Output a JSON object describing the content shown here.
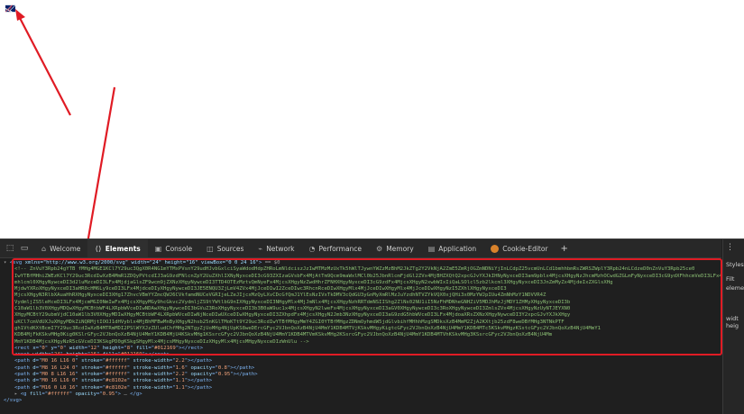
{
  "devtools": {
    "tabs": [
      {
        "label": "Welcome",
        "icon": "home-icon"
      },
      {
        "label": "Elements",
        "icon": "elements-icon",
        "active": true
      },
      {
        "label": "Console",
        "icon": "console-icon"
      },
      {
        "label": "Sources",
        "icon": "sources-icon"
      },
      {
        "label": "Network",
        "icon": "network-icon"
      },
      {
        "label": "Performance",
        "icon": "performance-icon"
      },
      {
        "label": "Memory",
        "icon": "memory-icon"
      },
      {
        "label": "Application",
        "icon": "application-icon"
      },
      {
        "label": "Cookie-Editor",
        "icon": "cookie-icon"
      }
    ],
    "add_tab": "+",
    "side": {
      "styles": "Styles",
      "filter": "Filt",
      "element": "element",
      "width": "widt",
      "heig": "heig"
    },
    "dom": {
      "svg_open_tag": "svg",
      "svg_attrs": "xmlns=\"http://www.w3.org/2000/svg\" width=\"24\" height=\"16\" viewBox=\"0 0 24 16\"",
      "svg_suffix": "== $0",
      "comment_lines": [
        "<!-- ZnVuY3Rpb24gYTB fMHg4MGE1KCl7Y29uc3QgX0R4NG1mYTMxPVsnY29udHJvbGxlciSyaWdodHdpZHRoLmNldciszJzIwMTMzMzUxTk5hWlTJywnYWZzMzBhM2JkZTg2Y2VkNjA2ZmE5ZmRjOGZmNDNiYjInLCdpZ25vcmUnLCd1bmhhbmRsZWRSZWplY3Rpb24nLCdzeD0nZnVuY3Rpb25ce0",
        "IwYTBfMHhiZWEzKCl7Y29uc3RcdIwXzB4MmR1ZDQyPVtcdIJ3aG9zdFNlcnZpY2UuZXhlIXNyNyxceDI3cG93ZXIzaGVsbFx4MjAtTm9Qcm9maWxlMCl0b25JbnRlcmFjdGl2ZVx4MjBHZXQtQ2xpcGJvYXJkIHNyNyxceDI3am9pblx4MjcsXHgyNzJhcmMzhOCwdGZGLmFyNyxceDI3cG9ydXFhhcmVeDI3LFx4MjdpbmhLcm",
        "mhlcml0XHgyNywceDI3d2luMzceDI3LFx4MjdjaGlsZF9wcm9jZXNzXHgyNywceDI3TTD4OTEzMztvQmNyeFx4MjcsXHgyNzZwdHhrZFNHXHgyNyxceDI3cG9zdFx4MjcsXHgyN2xwbWIxIiQaLSOlcl5zb2lkcml3XHgyNyxceDI3JnZmMyZx4MjdeIxZXGlsXHg",
        "MjdwYXRoXHgyNyxceDI3aHR0cHM6Ly9ceDI3LFx4MjdceDIyXHgyNywceDI3JE5ENQU3ZjLmV4ZVx4MjJceDIwI2ZceDIwc3RhcnRceDIwXHgyMlx4MjJceDIwXHgyMlx4MjJceDIwXHgyNzI5ZXhlXHgyNyxceDI3",
        "MjcsXHgyN3RlbXAuaHhRXHgyNyxceDI3XHg17ZhvcVBmYYZmcQWJ6CVkfamdNUCeVGRIjeLZeJIjcxMzQyLXvCDcGfQmJ1YlEsNzIVxTkDMV3cQdGU3yGnMyXmRlMzJuYzdhNTVZYkVQX0xjQHi3x0MzYWJpIUu4ZmNhMzY1NDVVR4Z",
        "VydmljZS5leHceDI3LFx4MjcmMGI0NmIwFx4MjcsXHgyMGy9hcGkvc2VydmljZS9tYWtlbG9nIXHgyNyxceDI3NHgyMlx4MjJmNlx4MjcsXHgyNzhRRTdmNSIIShg2ZlNs02NU1iI5NzFhMDNheGNHZiV5MDJhMzJjMDY1ZHMyXHgyNyxceDI3b",
        "C10aW1lb3V0XHgyMDQwXHgyMCBtbWF4LXRpbWVceDIwNDAwXHgyNywceDI3bGVuZ3RoXHgyNyxceDI3b3B0aW9uc1x4MjcsXHgyN2lweFx4MjcsXHgyNyxceDI3aGV0XHgyNywceDI3c3RoXHgyNywceDI3ZmlsZVx4MjcsXHgyNzUyNTJEYXN0",
        "XHgyMCBtY29ubmVjdC10aW1lb3V0XHgyMDIwXHgyMCBtbWF4LXRpbWVceDIwNjNceDIwUXceDIwXHgyNyxceDI3ZXhpdFx4MjcsXHgyN2Jmb3NzXHgyNyxceDI3aG9zdG5hbWVceDI3LFx4MjdoaXRsZXNzXHgyNywceDI3Y2xpcGJvYXJkXHgy",
        "uKCl7cmVdUXJuXHgyMDkZiNQRMjtIOOJ1dHVyblx4MjBhMFBwMnByXHgyN2hsb25nKGlTMoKTt9Y29uc3RcdIwYTBfMHgyMmY4ZGI0YTBfMHgzZDNmOyhmdW5jdGlvbihfMHhhMzgSMDksXzB4MmM2ZjA2KXtjb25zdF8weDBfMHg3NTNkPTF",
        "gh1VtdKXtBcmI7Y29uc3RcdIwXzB4MTRmMDI2PSlWYXJzZUludChfMHg2NTgyZjUoMHg4NjUpKS8weDErcGFyc2VJbnQoXzB4NjU4MmY1KDB4MTVjKSkvMHgyKigtcGFyc2VJbnQoXzB4NjU4MmY1KDB4MTc5KSkvMHgzKSstcGFyc2VJbnQoXzB4NjU4MmY1",
        "KDB4MjFkKSkvMHg0Kig0KSlrGFyc2VJbnQoXzB4NjU4MmY1KDB4MjU4KSkvMHg1KSsrcGFyc2VJbnQoXzB4NjU4MmY1KDB4MTVmKSkvMHg2KSsrcGFyc2VJbnQoXzB4NjU4MmY1KDB4MTVhKSkvMHg3KSsrcGFyc2VJbnQoXzB4NjU4Mm",
        "MmY1KDB4MjcsXHgyNzR5cGVceDI3KSkgPD0gKSkgSHgyMlx4MjcsMHgyNyxceDIzXHgyMlx4MjcsMHgyNyxceDIzWnUlu -->"
      ],
      "children": [
        {
          "tag": "rect",
          "attrs": [
            [
              "x",
              "0"
            ],
            [
              "y",
              "0"
            ],
            [
              "width",
              "12"
            ],
            [
              "height",
              "8"
            ],
            [
              "fill",
              "#012169"
            ]
          ],
          "close": "</rect>"
        },
        {
          "tag": "rect",
          "attrs": [
            [
              "width",
              "24"
            ],
            [
              "height",
              "16"
            ],
            [
              "fill",
              "#012169"
            ]
          ],
          "close": "</rect>"
        },
        {
          "tag": "path",
          "attrs": [
            [
              "d",
              "M0 16 L16 0"
            ],
            [
              "stroke",
              "#ffffff"
            ],
            [
              "stroke-width",
              "2.2"
            ]
          ],
          "close": "</path>"
        },
        {
          "tag": "path",
          "attrs": [
            [
              "d",
              "M8 16 L24 0"
            ],
            [
              "stroke",
              "#ffffff"
            ],
            [
              "stroke-width",
              "1.6"
            ],
            [
              "opacity",
              "0.8"
            ]
          ],
          "close": "</path>"
        },
        {
          "tag": "path",
          "attrs": [
            [
              "d",
              "M0 8 L16 16"
            ],
            [
              "stroke",
              "#ffffff"
            ],
            [
              "stroke-width",
              "2.2"
            ],
            [
              "opacity",
              "0.95"
            ]
          ],
          "close": "</path>"
        },
        {
          "tag": "path",
          "attrs": [
            [
              "d",
              "M0 16 L16 0"
            ],
            [
              "stroke",
              "#c8102e"
            ],
            [
              "stroke-width",
              "1.1"
            ]
          ],
          "close": "</path>"
        },
        {
          "tag": "path",
          "attrs": [
            [
              "d",
              "M16 0 L8 16"
            ],
            [
              "stroke",
              "#c8102e"
            ],
            [
              "stroke-width",
              "1.1"
            ]
          ],
          "close": "</path>"
        },
        {
          "tag": "g",
          "attrs": [
            [
              "fill",
              "#ffffff"
            ],
            [
              "opacity",
              "0.95"
            ]
          ],
          "close": "</g>",
          "collapsed": true
        }
      ]
    }
  },
  "colors": {
    "highlight": "#e01b24",
    "flag_blue": "#012169",
    "flag_red": "#c8102e"
  }
}
